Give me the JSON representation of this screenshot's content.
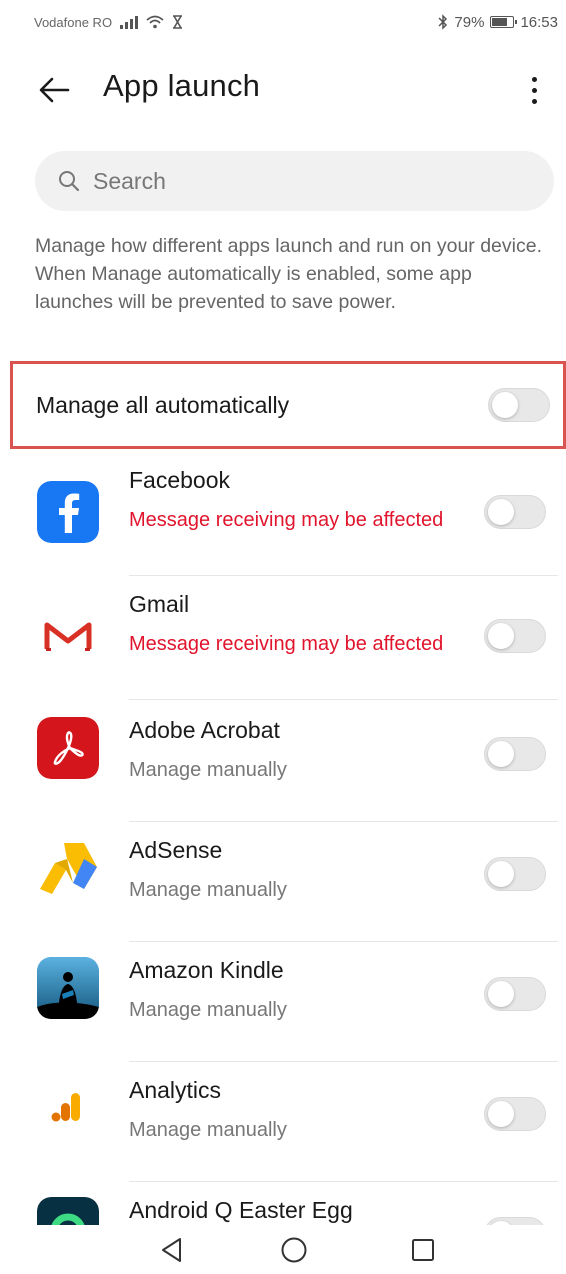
{
  "status_bar": {
    "carrier": "Vodafone RO",
    "battery": "79%",
    "battery_level": 0.79,
    "time": "16:53",
    "icons": [
      "signal-icon",
      "wifi-icon",
      "hourglass-icon",
      "bluetooth-icon",
      "battery-icon"
    ]
  },
  "header": {
    "title": "App launch",
    "back_icon": "arrow-left-icon",
    "menu_icon": "more-vertical-icon"
  },
  "search": {
    "placeholder": "Search",
    "value": ""
  },
  "description": "Manage how different apps launch and run on your device. When Manage automatically is enabled, some app launches will be prevented to save power.",
  "manage_all": {
    "label": "Manage all automatically",
    "enabled": false
  },
  "apps": [
    {
      "name": "Facebook",
      "status": "Message receiving may be affected",
      "status_type": "warning",
      "enabled": false,
      "icon": "facebook-icon"
    },
    {
      "name": "Gmail",
      "status": "Message receiving may be affected",
      "status_type": "warning",
      "enabled": false,
      "icon": "gmail-icon"
    },
    {
      "name": "Adobe Acrobat",
      "status": "Manage manually",
      "status_type": "normal",
      "enabled": false,
      "icon": "adobe-acrobat-icon"
    },
    {
      "name": "AdSense",
      "status": "Manage manually",
      "status_type": "normal",
      "enabled": false,
      "icon": "adsense-icon"
    },
    {
      "name": "Amazon Kindle",
      "status": "Manage manually",
      "status_type": "normal",
      "enabled": false,
      "icon": "kindle-icon"
    },
    {
      "name": "Analytics",
      "status": "Manage manually",
      "status_type": "normal",
      "enabled": false,
      "icon": "analytics-icon"
    },
    {
      "name": "Android Q Easter Egg",
      "status": "",
      "status_type": "normal",
      "enabled": false,
      "icon": "android-q-icon"
    }
  ],
  "colors": {
    "warning": "#e1142d",
    "highlight_border": "#d9534f",
    "toggle_off": "#e8e8e8"
  },
  "nav": {
    "back_icon": "nav-back-triangle-icon",
    "home_icon": "nav-home-circle-icon",
    "recents_icon": "nav-recents-square-icon"
  }
}
